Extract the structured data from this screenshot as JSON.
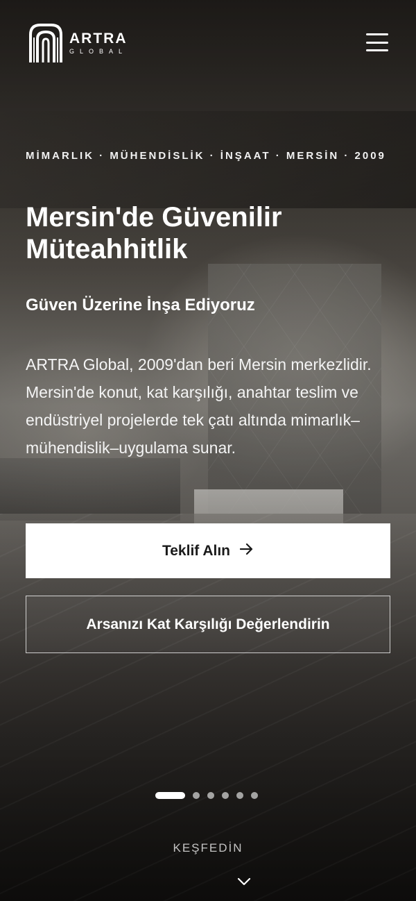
{
  "header": {
    "logo_name": "ARTRA",
    "logo_sub": "GLOBAL",
    "menu_icon": "hamburger-menu-icon"
  },
  "hero": {
    "kicker": "MİMARLIK · MÜHENDİSLİK · İNŞAAT · MERSİN · 2009",
    "title": "Mersin'de Güvenilir Müteahhitlik",
    "subtitle": "Güven Üzerine İnşa Ediyoruz",
    "description": "ARTRA Global, 2009'dan beri Mersin merkezlidir. Mersin'de konut, kat karşılığı, anahtar teslim ve endüstriyel projelerde tek çatı altında mimarlık–mühendislik–uygulama sunar.",
    "primary_button": "Teklif Alın",
    "primary_button_icon": "arrow-right-icon",
    "secondary_button": "Arsanızı Kat Karşılığı Değerlendirin"
  },
  "slider": {
    "total_slides": 6,
    "active_slide": 1
  },
  "explore": {
    "label": "KEŞFEDİN",
    "icon": "chevron-down-icon"
  },
  "colors": {
    "primary_button_bg": "#ffffff",
    "primary_button_text": "#1a1a1a",
    "text": "#ffffff"
  }
}
